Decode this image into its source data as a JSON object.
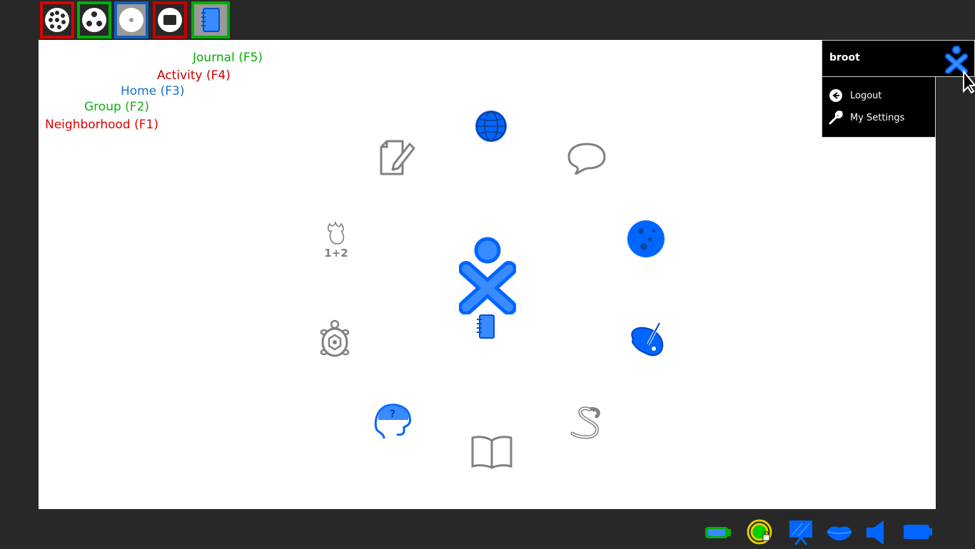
{
  "frame": {
    "zoom_buttons": [
      {
        "name": "neighborhood",
        "icon": "neighborhood-view-icon",
        "border": "#e00000"
      },
      {
        "name": "group",
        "icon": "group-view-icon",
        "border": "#00b000"
      },
      {
        "name": "home",
        "icon": "home-view-icon",
        "border": "#1060c0"
      },
      {
        "name": "activity",
        "icon": "activity-view-icon",
        "border": "#c80000"
      },
      {
        "name": "journal",
        "icon": "journal-icon",
        "border": "#00b000"
      }
    ]
  },
  "view_labels": {
    "journal": "Journal (F5)",
    "activity": "Activity (F4)",
    "home": "Home (F3)",
    "group": "Group (F2)",
    "neighborhood": "Neighborhood (F1)"
  },
  "colors": {
    "journal": "#00b000",
    "activity": "#c80000",
    "home": "#1c6fc4",
    "group": "#10b010",
    "neighborhood": "#e00000",
    "xo_blue": "#0066ff",
    "inactive_gray": "#808080"
  },
  "home_ring": [
    {
      "icon": "browse-globe-icon",
      "active": true
    },
    {
      "icon": "chat-bubble-icon",
      "active": false
    },
    {
      "icon": "moon-icon",
      "active": true
    },
    {
      "icon": "paint-palette-icon",
      "active": true
    },
    {
      "icon": "pippy-snake-icon",
      "active": false
    },
    {
      "icon": "read-book-icon",
      "active": false
    },
    {
      "icon": "help-head-icon",
      "active": true
    },
    {
      "icon": "turtle-art-icon",
      "active": false
    },
    {
      "icon": "calculate-icon",
      "active": false
    },
    {
      "icon": "write-icon",
      "active": false
    }
  ],
  "center": {
    "icon": "xo-buddy-icon",
    "journal_icon": "journal-icon"
  },
  "buddy_palette": {
    "username": "broot",
    "menu": [
      {
        "label": "Logout",
        "icon": "logout-icon"
      },
      {
        "label": "My Settings",
        "icon": "wrench-icon"
      }
    ]
  },
  "tray": [
    {
      "icon": "battery-icon"
    },
    {
      "icon": "wireless-network-icon"
    },
    {
      "icon": "frame-display-icon"
    },
    {
      "icon": "speech-lips-icon"
    },
    {
      "icon": "speaker-volume-icon"
    },
    {
      "icon": "battery-level-icon"
    }
  ]
}
